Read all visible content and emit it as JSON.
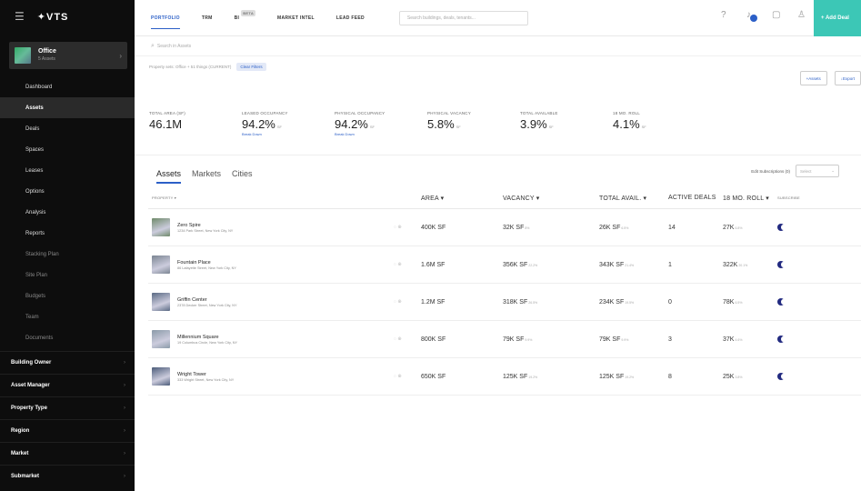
{
  "sidebar": {
    "logo": "VTS",
    "workspace": {
      "name": "Office",
      "subtitle": "5 Assets"
    },
    "nav": [
      {
        "label": "Dashboard"
      },
      {
        "label": "Assets"
      },
      {
        "label": "Deals"
      },
      {
        "label": "Spaces"
      },
      {
        "label": "Leases"
      },
      {
        "label": "Options"
      },
      {
        "label": "Analysis"
      },
      {
        "label": "Reports"
      },
      {
        "label": "Stacking Plan"
      },
      {
        "label": "Site Plan"
      },
      {
        "label": "Budgets"
      },
      {
        "label": "Team"
      },
      {
        "label": "Documents"
      }
    ],
    "filters": [
      {
        "label": "Building Owner"
      },
      {
        "label": "Asset Manager"
      },
      {
        "label": "Property Type"
      },
      {
        "label": "Region"
      },
      {
        "label": "Market"
      },
      {
        "label": "Submarket"
      }
    ]
  },
  "topbar": {
    "tabs": [
      "PORTFOLIO",
      "TRM",
      "BI",
      "MARKET INTEL",
      "LEAD FEED"
    ],
    "beta": "BETA",
    "search_placeholder": "Search buildings, deals, tenants...",
    "add_label": "+ Add Deal"
  },
  "search": {
    "placeholder": "Search in Assets"
  },
  "filter_line": {
    "text": "Property sets: Office  +  51 things  (CURRENT)",
    "clear": "Clear Filters"
  },
  "actions": {
    "assets": "Assets",
    "export": "Export"
  },
  "stats": [
    {
      "label": "TOTAL AREA (SF)",
      "value": "46.1M",
      "unit": "",
      "link": ""
    },
    {
      "label": "LEASED OCCUPANCY",
      "value": "94.2%",
      "unit": "SF",
      "link": "Break Down"
    },
    {
      "label": "PHYSICAL OCCUPANCY",
      "value": "94.2%",
      "unit": "SF",
      "link": "Break Down"
    },
    {
      "label": "PHYSICAL VACANCY",
      "value": "5.8%",
      "unit": "SF",
      "link": ""
    },
    {
      "label": "TOTAL AVAILABLE",
      "value": "3.9%",
      "unit": "SF",
      "link": ""
    },
    {
      "label": "18 MO. ROLL",
      "value": "4.1%",
      "unit": "SF",
      "link": ""
    }
  ],
  "tabs": [
    "Assets",
    "Markets",
    "Cities"
  ],
  "subscriptions": {
    "label": "Edit Subscriptions (0)",
    "select_placeholder": "Select"
  },
  "table": {
    "headers": {
      "property": "PROPERTY ▾",
      "area": "AREA ▾",
      "vacancy": "VACANCY ▾",
      "total_avail": "TOTAL AVAIL. ▾",
      "active_deals": "ACTIVE DEALS",
      "roll": "18 MO. ROLL ▾",
      "subscribe": "SUBSCRIBE"
    },
    "rows": [
      {
        "name": "Zero Spire",
        "address": "1234 Park Street, New York City, NY",
        "area": "400K SF",
        "vacancy": "32K SF",
        "vacancy_pct": "8%",
        "avail": "26K SF",
        "avail_pct": "6.5%",
        "deals": "14",
        "roll": "27K",
        "roll_pct": "6.8%",
        "thumb": "#6f8a6a"
      },
      {
        "name": "Fountain Place",
        "address": "86 Lafayette Street, New York City, NY",
        "area": "1.6M SF",
        "vacancy": "356K SF",
        "vacancy_pct": "22.2%",
        "avail": "343K SF",
        "avail_pct": "21.4%",
        "deals": "1",
        "roll": "322K",
        "roll_pct": "20.1%",
        "thumb": "#7b8592"
      },
      {
        "name": "Griffin Center",
        "address": "2378 Decker Street, New York City, NY",
        "area": "1.2M SF",
        "vacancy": "318K SF",
        "vacancy_pct": "26.5%",
        "avail": "234K SF",
        "avail_pct": "19.5%",
        "deals": "0",
        "roll": "78K",
        "roll_pct": "6.5%",
        "thumb": "#5a6a84"
      },
      {
        "name": "Millennium Square",
        "address": "19 Columbus Circle, New York City, NY",
        "area": "800K SF",
        "vacancy": "79K SF",
        "vacancy_pct": "9.9%",
        "avail": "79K SF",
        "avail_pct": "9.9%",
        "deals": "3",
        "roll": "37K",
        "roll_pct": "4.6%",
        "thumb": "#8a9aa8"
      },
      {
        "name": "Wright Tower",
        "address": "333 Wright Street, New York City, NY",
        "area": "650K SF",
        "vacancy": "125K SF",
        "vacancy_pct": "19.2%",
        "avail": "125K SF",
        "avail_pct": "19.2%",
        "deals": "8",
        "roll": "25K",
        "roll_pct": "3.8%",
        "thumb": "#4c5c7a"
      }
    ]
  },
  "colors": {
    "accent": "#2b5fc7",
    "teal": "#3cc7b6",
    "sidebar": "#0d0d0d"
  }
}
